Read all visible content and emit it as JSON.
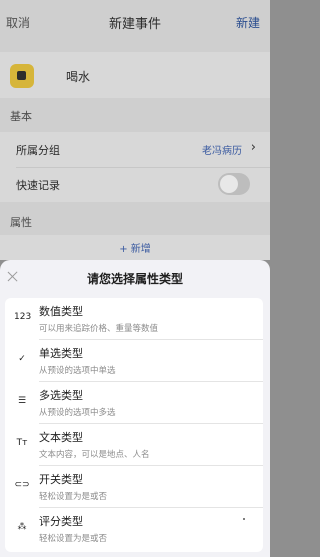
{
  "nav": {
    "cancel_label": "取消",
    "title": "新建事件",
    "new_label": "新建"
  },
  "event": {
    "name": "喝水",
    "icon": "cup-icon"
  },
  "basic_section": {
    "label": "基本",
    "rows": [
      {
        "label": "所属分组",
        "value": "老冯病历"
      },
      {
        "label": "快速记录",
        "toggle": false
      }
    ]
  },
  "attributes_section": {
    "label": "属性",
    "add_label": "+ 新增"
  },
  "sheet": {
    "title": "请您选择属性类型",
    "options": [
      {
        "icon": "123",
        "title": "数值类型",
        "desc": "可以用来追踪价格、重量等数值"
      },
      {
        "icon": "✓",
        "title": "单选类型",
        "desc": "从预设的选项中单选"
      },
      {
        "icon": "☰",
        "title": "多选类型",
        "desc": "从预设的选项中多选"
      },
      {
        "icon": "Tт",
        "title": "文本类型",
        "desc": "文本内容，可以是地点、人名"
      },
      {
        "icon": "⊂⊃",
        "title": "开关类型",
        "desc": "轻松设置为是或否"
      },
      {
        "icon": "⁂",
        "title": "评分类型",
        "desc": "轻松设置为是或否"
      }
    ]
  }
}
